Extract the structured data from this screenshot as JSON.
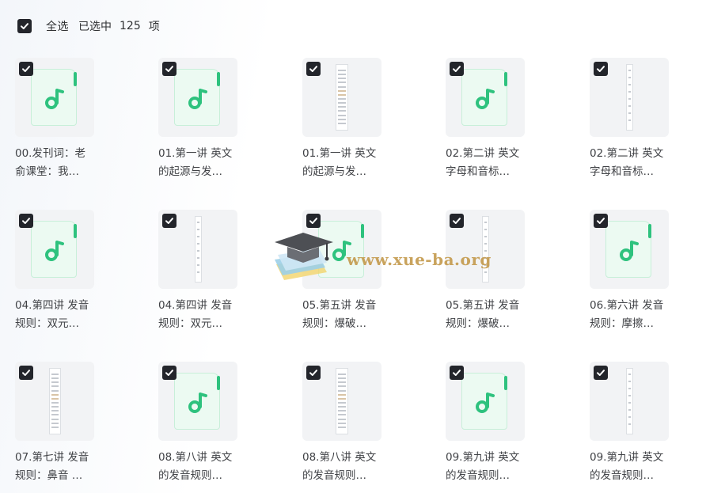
{
  "header": {
    "select_all_label": "全选",
    "selected_prefix": "已选中",
    "selected_count": "125",
    "selected_unit": "项"
  },
  "files": [
    {
      "line1": "00.发刊词：老",
      "line2": "俞课堂：我…",
      "thumb": "audio",
      "checked": true
    },
    {
      "line1": "01.第一讲 英文",
      "line2": "的起源与发…",
      "thumb": "audio",
      "checked": true
    },
    {
      "line1": "01.第一讲 英文",
      "line2": "的起源与发…",
      "thumb": "document",
      "checked": true
    },
    {
      "line1": "02.第二讲 英文",
      "line2": "字母和音标…",
      "thumb": "audio",
      "checked": true
    },
    {
      "line1": "02.第二讲 英文",
      "line2": "字母和音标…",
      "thumb": "document",
      "checked": true
    },
    {
      "line1": "04.第四讲 发音",
      "line2": "规则：双元…",
      "thumb": "audio",
      "checked": true
    },
    {
      "line1": "04.第四讲 发音",
      "line2": "规则：双元…",
      "thumb": "document",
      "checked": true
    },
    {
      "line1": "05.第五讲 发音",
      "line2": "规则：爆破…",
      "thumb": "audio",
      "checked": true
    },
    {
      "line1": "05.第五讲 发音",
      "line2": "规则：爆破…",
      "thumb": "document",
      "checked": true
    },
    {
      "line1": "06.第六讲 发音",
      "line2": "规则：摩擦…",
      "thumb": "audio",
      "checked": true
    },
    {
      "line1": "07.第七讲 发音",
      "line2": "规则：鼻音 …",
      "thumb": "document",
      "checked": true
    },
    {
      "line1": "08.第八讲 英文",
      "line2": "的发音规则…",
      "thumb": "audio",
      "checked": true
    },
    {
      "line1": "08.第八讲 英文",
      "line2": "的发音规则…",
      "thumb": "document",
      "checked": true
    },
    {
      "line1": "09.第九讲 英文",
      "line2": "的发音规则…",
      "thumb": "audio",
      "checked": true
    },
    {
      "line1": "09.第九讲 英文",
      "line2": "的发音规则…",
      "thumb": "document",
      "checked": true
    }
  ],
  "watermark": {
    "text": "www.xue-ba.org",
    "icon": "graduation-cap-books-icon"
  },
  "colors": {
    "checkbox": "#23252b",
    "audio_accent": "#2ec27e",
    "thumb_bg": "#f2f3f5",
    "caption_text": "#404246",
    "watermark_text": "#c49a4c"
  }
}
